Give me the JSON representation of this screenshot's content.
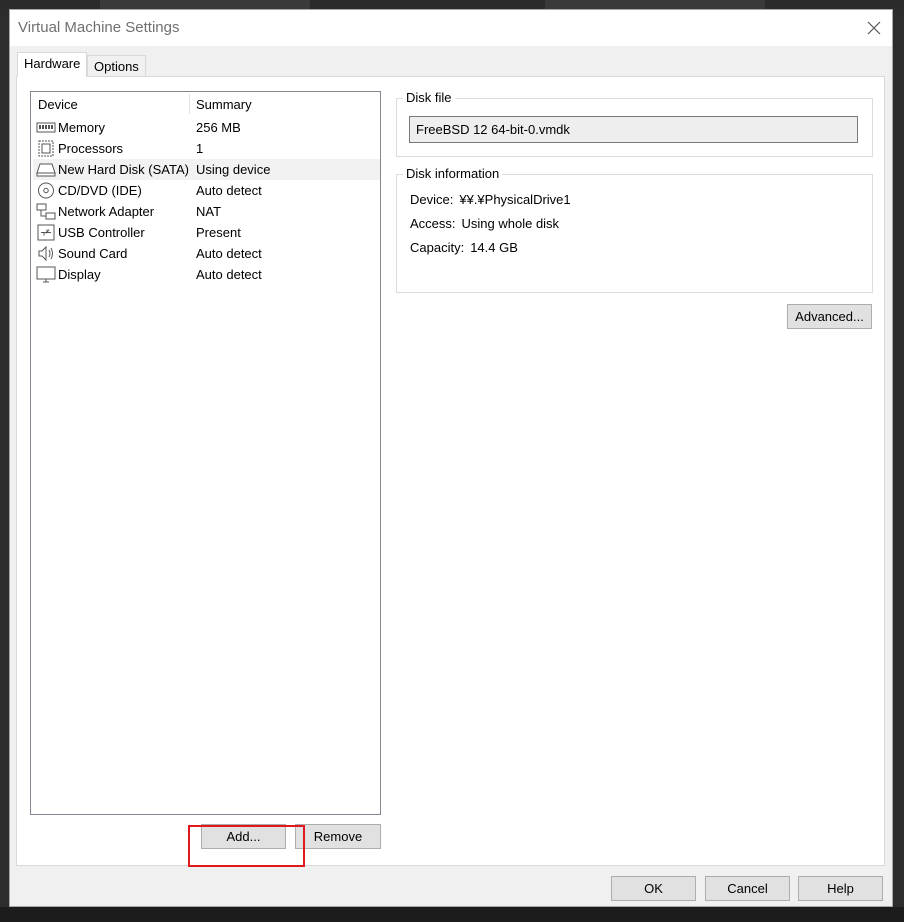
{
  "dialog": {
    "title": "Virtual Machine Settings"
  },
  "tabs": [
    {
      "label": "Hardware",
      "active": true
    },
    {
      "label": "Options",
      "active": false
    }
  ],
  "device_list": {
    "headers": {
      "device": "Device",
      "summary": "Summary"
    },
    "rows": [
      {
        "icon": "memory-icon",
        "device": "Memory",
        "summary": "256 MB",
        "selected": false
      },
      {
        "icon": "processor-icon",
        "device": "Processors",
        "summary": "1",
        "selected": false
      },
      {
        "icon": "hard-disk-icon",
        "device": "New Hard Disk (SATA)",
        "summary": "Using device",
        "selected": true
      },
      {
        "icon": "cd-dvd-icon",
        "device": "CD/DVD (IDE)",
        "summary": "Auto detect",
        "selected": false
      },
      {
        "icon": "network-adapter-icon",
        "device": "Network Adapter",
        "summary": "NAT",
        "selected": false
      },
      {
        "icon": "usb-icon",
        "device": "USB Controller",
        "summary": "Present",
        "selected": false
      },
      {
        "icon": "sound-icon",
        "device": "Sound Card",
        "summary": "Auto detect",
        "selected": false
      },
      {
        "icon": "display-icon",
        "device": "Display",
        "summary": "Auto detect",
        "selected": false
      }
    ]
  },
  "list_buttons": {
    "add": "Add...",
    "remove": "Remove"
  },
  "disk_file": {
    "group_label": "Disk file",
    "value": "FreeBSD 12 64-bit-0.vmdk"
  },
  "disk_info": {
    "group_label": "Disk information",
    "device_label": "Device:",
    "device_value": "¥¥.¥PhysicalDrive1",
    "access_label": "Access:",
    "access_value": "Using whole disk",
    "capacity_label": "Capacity:",
    "capacity_value": "14.4 GB"
  },
  "advanced_button": "Advanced...",
  "footer": {
    "ok": "OK",
    "cancel": "Cancel",
    "help": "Help"
  },
  "colors": {
    "highlight": "#e0191f",
    "selected_row": "#f2f2f2"
  }
}
